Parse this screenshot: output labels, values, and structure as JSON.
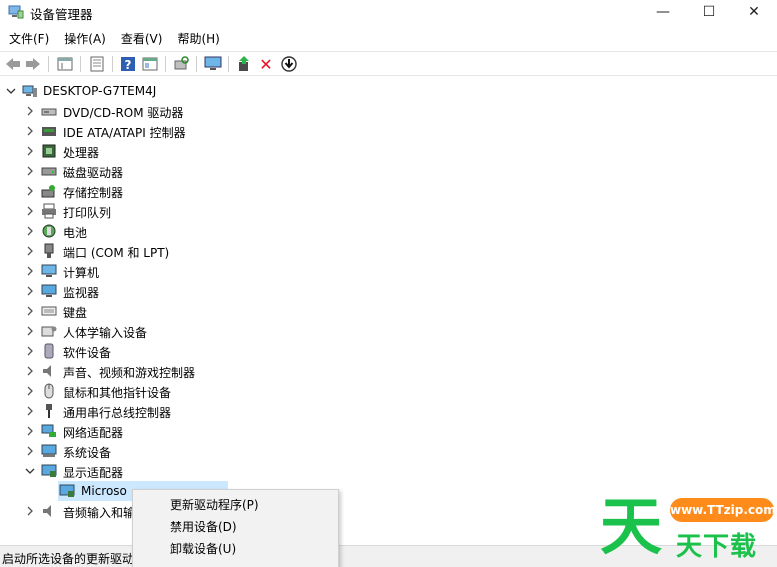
{
  "window": {
    "title": "设备管理器",
    "minimize": "—",
    "maximize": "☐",
    "close": "✕"
  },
  "menu": [
    "文件(F)",
    "操作(A)",
    "查看(V)",
    "帮助(H)"
  ],
  "toolbar": {
    "icons": [
      "back-icon",
      "forward-icon",
      "properties-icon",
      "show-hidden-icon",
      "help-icon",
      "view-icon",
      "scan-hardware-icon",
      "monitor-icon",
      "update-driver-icon",
      "uninstall-icon",
      "download-icon"
    ],
    "uninstall_glyph": "✕",
    "download_glyph": "⬇"
  },
  "tree": {
    "root": "DESKTOP-G7TEM4J",
    "categories": [
      {
        "label": "DVD/CD-ROM 驱动器",
        "icon": "dvd-drive-icon",
        "expanded": false
      },
      {
        "label": "IDE ATA/ATAPI 控制器",
        "icon": "ide-controller-icon",
        "expanded": false
      },
      {
        "label": "处理器",
        "icon": "processor-icon",
        "expanded": false
      },
      {
        "label": "磁盘驱动器",
        "icon": "disk-drive-icon",
        "expanded": false
      },
      {
        "label": "存储控制器",
        "icon": "storage-controller-icon",
        "expanded": false
      },
      {
        "label": "打印队列",
        "icon": "printer-icon",
        "expanded": false
      },
      {
        "label": "电池",
        "icon": "battery-icon",
        "expanded": false
      },
      {
        "label": "端口 (COM 和 LPT)",
        "icon": "port-icon",
        "expanded": false
      },
      {
        "label": "计算机",
        "icon": "computer-icon",
        "expanded": false
      },
      {
        "label": "监视器",
        "icon": "monitor-icon",
        "expanded": false
      },
      {
        "label": "键盘",
        "icon": "keyboard-icon",
        "expanded": false
      },
      {
        "label": "人体学输入设备",
        "icon": "hid-icon",
        "expanded": false
      },
      {
        "label": "软件设备",
        "icon": "software-device-icon",
        "expanded": false
      },
      {
        "label": "声音、视频和游戏控制器",
        "icon": "sound-icon",
        "expanded": false
      },
      {
        "label": "鼠标和其他指针设备",
        "icon": "mouse-icon",
        "expanded": false
      },
      {
        "label": "通用串行总线控制器",
        "icon": "usb-icon",
        "expanded": false
      },
      {
        "label": "网络适配器",
        "icon": "network-adapter-icon",
        "expanded": false
      },
      {
        "label": "系统设备",
        "icon": "system-device-icon",
        "expanded": false
      },
      {
        "label": "显示适配器",
        "icon": "display-adapter-icon",
        "expanded": true
      },
      {
        "label": "Microso",
        "icon": "display-adapter-icon",
        "child": true,
        "selected": true
      },
      {
        "label": "音频输入和输",
        "icon": "audio-io-icon",
        "expanded": false
      }
    ]
  },
  "status": "启动所选设备的更新驱动",
  "context_menu": [
    "更新驱动程序(P)",
    "禁用设备(D)",
    "卸载设备(U)"
  ],
  "watermark": {
    "big": "天",
    "badge": "www.TTzip.com",
    "small": "天下载"
  },
  "colors": {
    "selection": "#cce8ff",
    "watermark_green": "#1ac24b",
    "watermark_orange": "#ff8c1a",
    "uninstall_red": "#e81123"
  }
}
